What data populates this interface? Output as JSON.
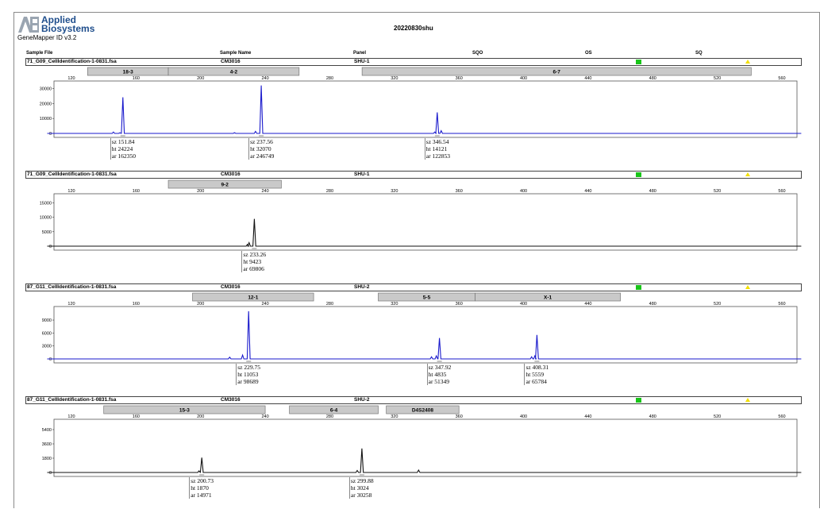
{
  "header": {
    "logo_line1": "Applied",
    "logo_line2": "Biosystems",
    "software": "GeneMapper ID v3.2",
    "doc_title": "20220830shu"
  },
  "columns": [
    "Sample File",
    "Sample Name",
    "Panel",
    "SQO",
    "OS",
    "SQ"
  ],
  "colors": {
    "green": "#19c519",
    "yellow": "#f3e000",
    "blue_trace": "#1a1acc",
    "black_trace": "#111111",
    "bin": "#c9c9c9"
  },
  "panels": [
    {
      "sample_file": "71_G09_CellIdentification-1-0831.fsa",
      "sample_name": "CM3016",
      "panel": "SHU-1",
      "bins": [
        {
          "label": "18-3",
          "start": 130,
          "end": 180
        },
        {
          "label": "4-2",
          "start": 180,
          "end": 261
        },
        {
          "label": "6-7",
          "start": 300,
          "end": 541
        }
      ],
      "annotations": [
        {
          "sz": "sz 151.84",
          "ht": "ht 24224",
          "ar": "ar 162350"
        },
        {
          "sz": "sz 237.56",
          "ht": "ht 32070",
          "ar": "ar 246749"
        },
        {
          "sz": "sz 346.54",
          "ht": "ht 14121",
          "ar": "ar 122853"
        }
      ]
    },
    {
      "sample_file": "71_G09_CellIdentification-1-0831.fsa",
      "sample_name": "CM3016",
      "panel": "SHU-1",
      "bins": [
        {
          "label": "9-2",
          "start": 180,
          "end": 250
        }
      ],
      "annotations": [
        {
          "sz": "sz 233.26",
          "ht": "ht 9423",
          "ar": "ar 69806"
        }
      ]
    },
    {
      "sample_file": "87_G11_CellIdentification-1-0831.fsa",
      "sample_name": "CM3016",
      "panel": "SHU-2",
      "bins": [
        {
          "label": "12-1",
          "start": 195,
          "end": 270
        },
        {
          "label": "5-5",
          "start": 310,
          "end": 370
        },
        {
          "label": "X-1",
          "start": 370,
          "end": 460
        }
      ],
      "annotations": [
        {
          "sz": "sz 229.75",
          "ht": "ht 11053",
          "ar": "ar 98689"
        },
        {
          "sz": "sz 347.92",
          "ht": "ht 4835",
          "ar": "ar 51349"
        },
        {
          "sz": "sz 408.31",
          "ht": "ht 5559",
          "ar": "ar 65784"
        }
      ]
    },
    {
      "sample_file": "87_G11_CellIdentification-1-0831.fsa",
      "sample_name": "CM3016",
      "panel": "SHU-2",
      "bins": [
        {
          "label": "15-3",
          "start": 140,
          "end": 240
        },
        {
          "label": "6-4",
          "start": 255,
          "end": 310
        },
        {
          "label": "D4S2408",
          "start": 315,
          "end": 360
        }
      ],
      "annotations": [
        {
          "sz": "sz 200.73",
          "ht": "ht 1870",
          "ar": "ar 14971"
        },
        {
          "sz": "sz 299.88",
          "ht": "ht 3024",
          "ar": "ar 30258"
        }
      ]
    }
  ],
  "chart_data": [
    {
      "type": "line",
      "xlabel": "",
      "ylabel": "",
      "x_ticks": [
        120,
        160,
        200,
        240,
        280,
        320,
        360,
        400,
        440,
        480,
        520,
        560
      ],
      "xlim": [
        105,
        572
      ],
      "y_ticks": [
        0,
        10000,
        20000,
        30000
      ],
      "ylim": [
        0,
        33000
      ],
      "color": "#1a1acc",
      "baseline_noise": [
        [
          146,
          900
        ],
        [
          150,
          400
        ],
        [
          221,
          500
        ],
        [
          234,
          1400
        ],
        [
          345,
          900
        ],
        [
          349,
          1800
        ]
      ],
      "peaks": [
        {
          "x": 151.84,
          "y": 24224
        },
        {
          "x": 237.56,
          "y": 32070
        },
        {
          "x": 346.54,
          "y": 14121
        }
      ]
    },
    {
      "type": "line",
      "xlabel": "",
      "ylabel": "",
      "x_ticks": [
        120,
        160,
        200,
        240,
        280,
        320,
        360,
        400,
        440,
        480,
        520,
        560
      ],
      "xlim": [
        105,
        572
      ],
      "y_ticks": [
        0,
        5000,
        10000,
        15000
      ],
      "ylim": [
        0,
        17000
      ],
      "color": "#111111",
      "baseline_noise": [
        [
          229,
          600
        ],
        [
          230,
          1200
        ]
      ],
      "peaks": [
        {
          "x": 233.26,
          "y": 9423
        }
      ]
    },
    {
      "type": "line",
      "xlabel": "",
      "ylabel": "",
      "x_ticks": [
        120,
        160,
        200,
        240,
        280,
        320,
        360,
        400,
        440,
        480,
        520,
        560
      ],
      "xlim": [
        105,
        572
      ],
      "y_ticks": [
        0,
        3000,
        6000,
        9000
      ],
      "ylim": [
        0,
        11400
      ],
      "color": "#1a1acc",
      "baseline_noise": [
        [
          218,
          400
        ],
        [
          226,
          900
        ],
        [
          343,
          500
        ],
        [
          346,
          700
        ],
        [
          405,
          500
        ],
        [
          407,
          700
        ]
      ],
      "peaks": [
        {
          "x": 229.75,
          "y": 11053
        },
        {
          "x": 347.92,
          "y": 4835
        },
        {
          "x": 408.31,
          "y": 5559
        }
      ]
    },
    {
      "type": "line",
      "xlabel": "",
      "ylabel": "",
      "x_ticks": [
        120,
        160,
        200,
        240,
        280,
        320,
        360,
        400,
        440,
        480,
        520,
        560
      ],
      "xlim": [
        105,
        572
      ],
      "y_ticks": [
        0,
        1800,
        3600,
        5400
      ],
      "ylim": [
        0,
        6300
      ],
      "color": "#111111",
      "baseline_noise": [
        [
          199,
          200
        ],
        [
          297,
          250
        ],
        [
          335,
          300
        ]
      ],
      "peaks": [
        {
          "x": 200.73,
          "y": 1870
        },
        {
          "x": 299.88,
          "y": 3024
        }
      ]
    }
  ]
}
